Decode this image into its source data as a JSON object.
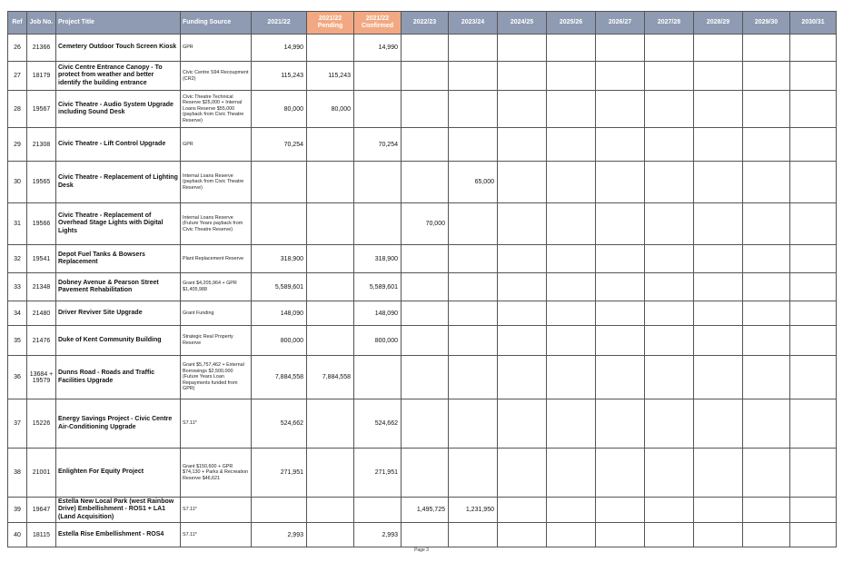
{
  "columns": [
    "Ref",
    "Job No.",
    "Project Title",
    "Funding Source",
    "2021/22",
    "2021/22 Pending",
    "2021/22 Confirmed",
    "2022/23",
    "2023/24",
    "2024/25",
    "2025/26",
    "2026/27",
    "2027/28",
    "2028/29",
    "2029/30",
    "2030/31"
  ],
  "column_colors": {
    "header": "#8f9bb3",
    "pending_confirmed": "#f2a983"
  },
  "rows": [
    {
      "ref": "26",
      "job": "21366",
      "title": "Cemetery Outdoor Touch Screen Kiosk",
      "funding": "GPR",
      "v2122": "14,990",
      "pending": "",
      "confirmed": "14,990",
      "v2223": "",
      "v2324": ""
    },
    {
      "ref": "27",
      "job": "18179",
      "title": "Civic Centre Entrance Canopy - To protect from weather and better identify the building entrance",
      "funding": "Civic Centre S94 Recoupment (CR2)",
      "v2122": "115,243",
      "pending": "115,243",
      "confirmed": "",
      "v2223": "",
      "v2324": ""
    },
    {
      "ref": "28",
      "job": "19567",
      "title": "Civic Theatre - Audio System Upgrade including Sound Desk",
      "funding": "Civic Theatre Technical Reserve $25,000 + Internal Loans Reserve $55,000 (payback from Civic Theatre Reserve)",
      "v2122": "80,000",
      "pending": "80,000",
      "confirmed": "",
      "v2223": "",
      "v2324": ""
    },
    {
      "ref": "29",
      "job": "21308",
      "title": "Civic Theatre - Lift Control Upgrade",
      "funding": "GPR",
      "v2122": "70,254",
      "pending": "",
      "confirmed": "70,254",
      "v2223": "",
      "v2324": ""
    },
    {
      "ref": "30",
      "job": "19565",
      "title": "Civic Theatre - Replacement of Lighting Desk",
      "funding": "Internal Loans Reserve (payback from Civic Theatre Reserve)",
      "v2122": "",
      "pending": "",
      "confirmed": "",
      "v2223": "",
      "v2324": "65,000"
    },
    {
      "ref": "31",
      "job": "19566",
      "title": "Civic Theatre - Replacement of Overhead Stage Lights with Digital Lights",
      "funding": "Internal Loans Reserve (Future Years payback from Civic Theatre Reserve)",
      "v2122": "",
      "pending": "",
      "confirmed": "",
      "v2223": "70,000",
      "v2324": ""
    },
    {
      "ref": "32",
      "job": "19541",
      "title": "Depot Fuel Tanks & Bowsers Replacement",
      "funding": "Plant Replacement Reserve",
      "v2122": "318,900",
      "pending": "",
      "confirmed": "318,900",
      "v2223": "",
      "v2324": ""
    },
    {
      "ref": "33",
      "job": "21348",
      "title": "Dobney Avenue & Pearson Street Pavement Rehabilitation",
      "funding": "Grant $4,205,964 + GPR $1,405,988",
      "v2122": "5,589,601",
      "pending": "",
      "confirmed": "5,589,601",
      "v2223": "",
      "v2324": ""
    },
    {
      "ref": "34",
      "job": "21480",
      "title": "Driver Reviver Site Upgrade",
      "funding": "Grant Funding",
      "v2122": "148,090",
      "pending": "",
      "confirmed": "148,090",
      "v2223": "",
      "v2324": ""
    },
    {
      "ref": "35",
      "job": "21476",
      "title": "Duke of Kent Community Building",
      "funding": "Strategic Real Property Reserve",
      "v2122": "800,000",
      "pending": "",
      "confirmed": "800,000",
      "v2223": "",
      "v2324": ""
    },
    {
      "ref": "36",
      "job": "13684 + 19579",
      "title": "Dunns Road - Roads and Traffic Facilities Upgrade",
      "funding": "Grant $5,757,462 + External Borrowings $2,500,000 (Future Years Loan Repayments funded from GPR)",
      "v2122": "7,884,558",
      "pending": "7,884,558",
      "confirmed": "",
      "v2223": "",
      "v2324": ""
    },
    {
      "ref": "37",
      "job": "15226",
      "title": "Energy Savings Project - Civic Centre Air-Conditioning Upgrade",
      "funding": "S7.11*",
      "v2122": "524,662",
      "pending": "",
      "confirmed": "524,662",
      "v2223": "",
      "v2324": ""
    },
    {
      "ref": "38",
      "job": "21001",
      "title": "Enlighten For Equity Project",
      "funding": "Grant $150,600 + GPR $74,130 + Parks & Recreation Reserve $46,621",
      "v2122": "271,951",
      "pending": "",
      "confirmed": "271,951",
      "v2223": "",
      "v2324": ""
    },
    {
      "ref": "39",
      "job": "19647",
      "title": "Estella New Local Park (west Rainbow Drive) Embellishment - ROS1 + LA1 (Land Acquisition)",
      "funding": "S7.11*",
      "v2122": "",
      "pending": "",
      "confirmed": "",
      "v2223": "1,495,725",
      "v2324": "1,231,950"
    },
    {
      "ref": "40",
      "job": "18115",
      "title": "Estella Rise Embellishment - ROS4",
      "funding": "S7.11*",
      "v2122": "2,993",
      "pending": "",
      "confirmed": "2,993",
      "v2223": "",
      "v2324": ""
    }
  ],
  "footer": "Page 3"
}
